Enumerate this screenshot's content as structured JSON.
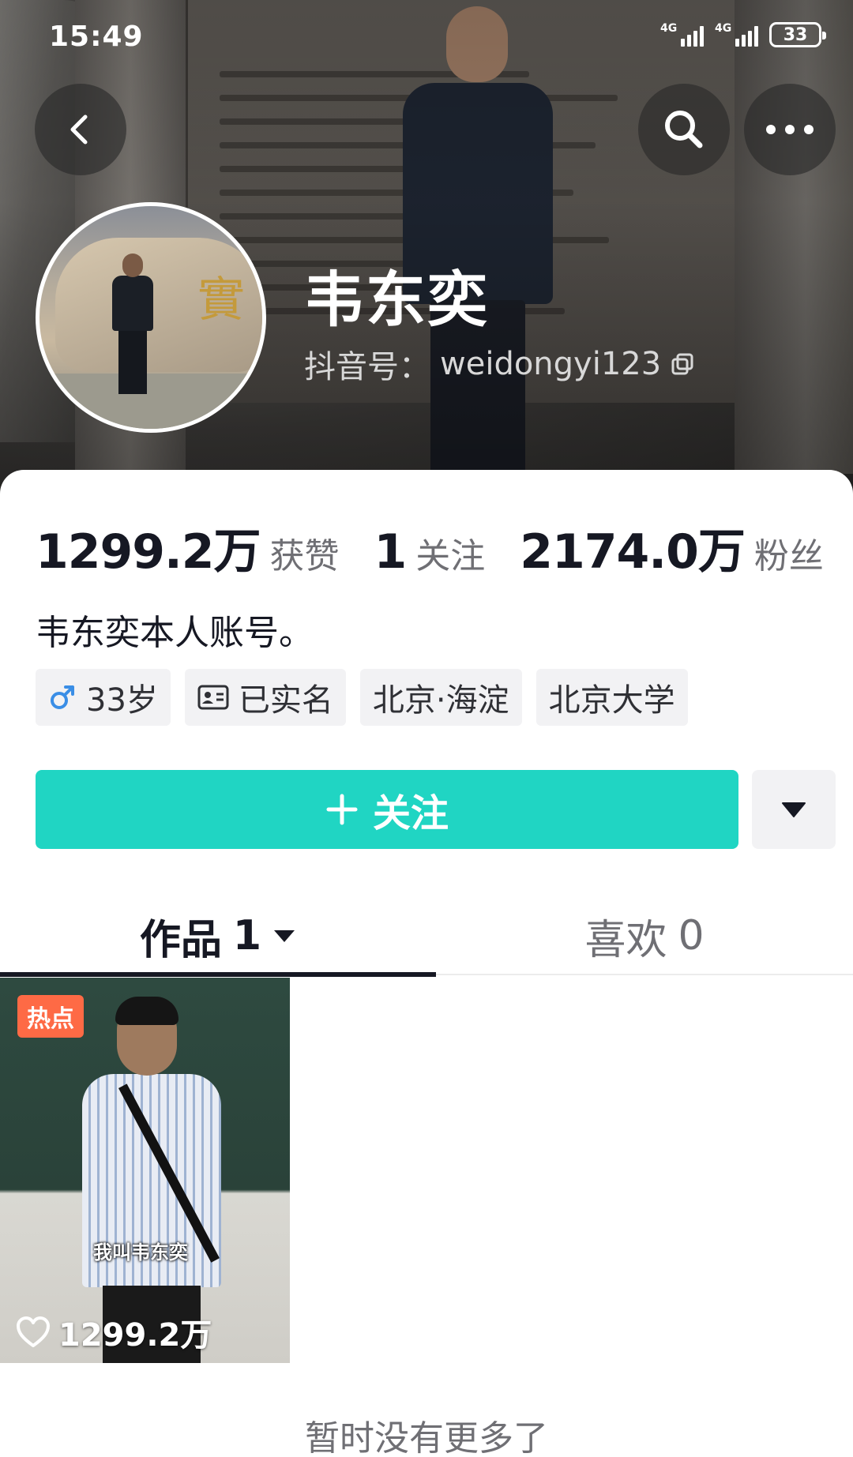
{
  "status_bar": {
    "time": "15:49",
    "network_1": "4G",
    "network_2": "4G",
    "battery": "33"
  },
  "profile": {
    "name": "韦东奕",
    "douyin_id_label": "抖音号：",
    "douyin_id": "weidongyi123"
  },
  "stats": [
    {
      "value": "1299.2万",
      "label": "获赞"
    },
    {
      "value": "1",
      "label": "关注"
    },
    {
      "value": "2174.0万",
      "label": "粉丝"
    }
  ],
  "bio": "韦东奕本人账号。",
  "tags": {
    "age": "33岁",
    "verified": "已实名",
    "location": "北京·海淀",
    "school": "北京大学"
  },
  "actions": {
    "follow_label": "关注"
  },
  "tabs": {
    "works_label": "作品",
    "works_count": "1",
    "likes_label": "喜欢",
    "likes_count": "0"
  },
  "video": {
    "badge": "热点",
    "caption": "我叫韦东奕",
    "likes": "1299.2万"
  },
  "footer": {
    "no_more": "暂时没有更多了"
  },
  "colors": {
    "accent": "#20d5c3",
    "male_icon": "#3a8ee6",
    "hot_badge": "#fe6a45"
  },
  "icons": [
    "back-icon",
    "search-icon",
    "more-icon",
    "copy-icon",
    "male-icon",
    "id-card-icon",
    "plus-icon",
    "caret-down-icon",
    "heart-icon"
  ]
}
